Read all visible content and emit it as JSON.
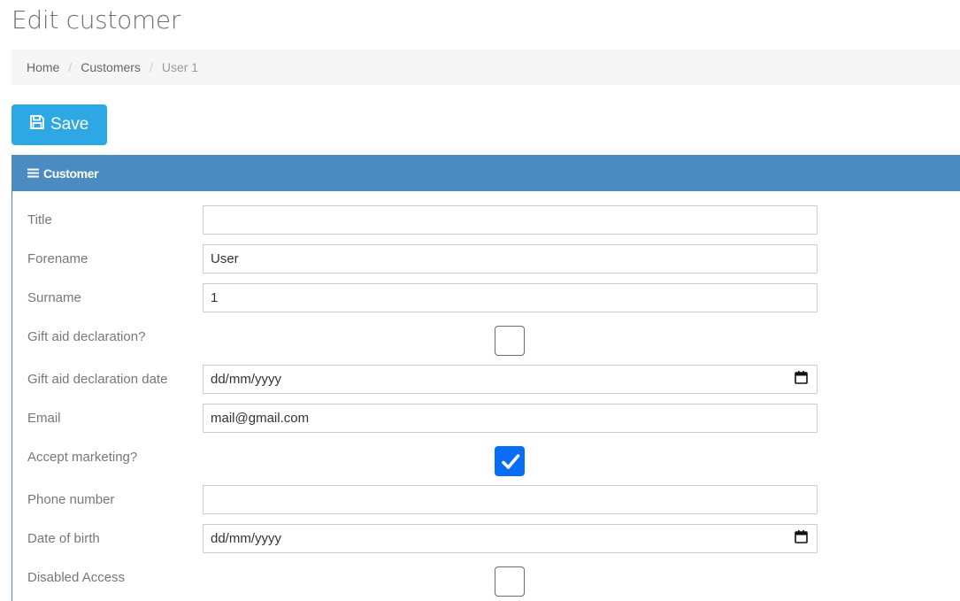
{
  "page": {
    "title": "Edit customer"
  },
  "breadcrumb": [
    {
      "label": "Home"
    },
    {
      "label": "Customers"
    },
    {
      "label": "User 1"
    }
  ],
  "toolbar": {
    "save_label": "Save",
    "save_icon": "floppy-disk-icon",
    "save_color": "#2ea8e5"
  },
  "panel": {
    "title": "Customer",
    "icon": "menu-bars-icon",
    "header_color": "#4a8bc2"
  },
  "fields": {
    "title": {
      "label": "Title",
      "value": ""
    },
    "forename": {
      "label": "Forename",
      "value": "User"
    },
    "surname": {
      "label": "Surname",
      "value": "1"
    },
    "gift_aid": {
      "label": "Gift aid declaration?",
      "checked": false
    },
    "gift_aid_date": {
      "label": "Gift aid declaration date",
      "value": "dd/mm/yyyy"
    },
    "email": {
      "label": "Email",
      "value": "mail@gmail.com"
    },
    "accept_marketing": {
      "label": "Accept marketing?",
      "checked": true
    },
    "phone": {
      "label": "Phone number",
      "value": ""
    },
    "dob": {
      "label": "Date of birth",
      "value": "dd/mm/yyyy"
    },
    "disabled_access": {
      "label": "Disabled Access",
      "checked": false
    }
  }
}
